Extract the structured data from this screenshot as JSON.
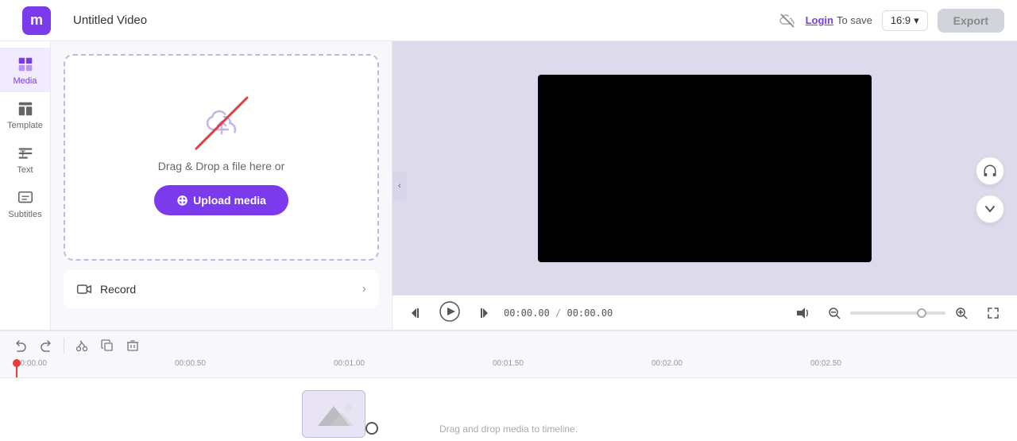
{
  "app": {
    "logo": "m",
    "title": "Untitled Video",
    "login_text": "To save",
    "login_label": "Login",
    "aspect_ratio": "16:9",
    "export_label": "Export"
  },
  "sidebar": {
    "items": [
      {
        "id": "media",
        "label": "Media",
        "active": true
      },
      {
        "id": "template",
        "label": "Template",
        "active": false
      },
      {
        "id": "text",
        "label": "Text",
        "active": false
      },
      {
        "id": "subtitles",
        "label": "Subtitles",
        "active": false
      }
    ]
  },
  "panel": {
    "upload": {
      "drag_text": "Drag & Drop a file here or",
      "button_label": "Upload media"
    },
    "record": {
      "label": "Record"
    }
  },
  "playback": {
    "current_time": "00:00.00",
    "total_time": "00:00.00"
  },
  "timeline": {
    "marks": [
      "00:00.00",
      "00:00.50",
      "00:01.00",
      "00:01.50",
      "00:02.00",
      "00:02.50"
    ],
    "drag_hint": "Drag and drop media to timeline."
  },
  "icons": {
    "media_icon": "⊞",
    "template_icon": "▦",
    "text_icon": "T",
    "subtitles_icon": "≡",
    "record_icon": "▭",
    "skip_back": "⏮",
    "play": "▶",
    "skip_fwd": "⏭",
    "volume": "🔊",
    "zoom_out": "−",
    "zoom_in": "+",
    "fullscreen": "⛶",
    "headphones": "🎧",
    "scroll_down": "∨",
    "undo": "↩",
    "redo": "↪",
    "cut": "✂",
    "copy": "⧉",
    "delete": "🗑"
  }
}
